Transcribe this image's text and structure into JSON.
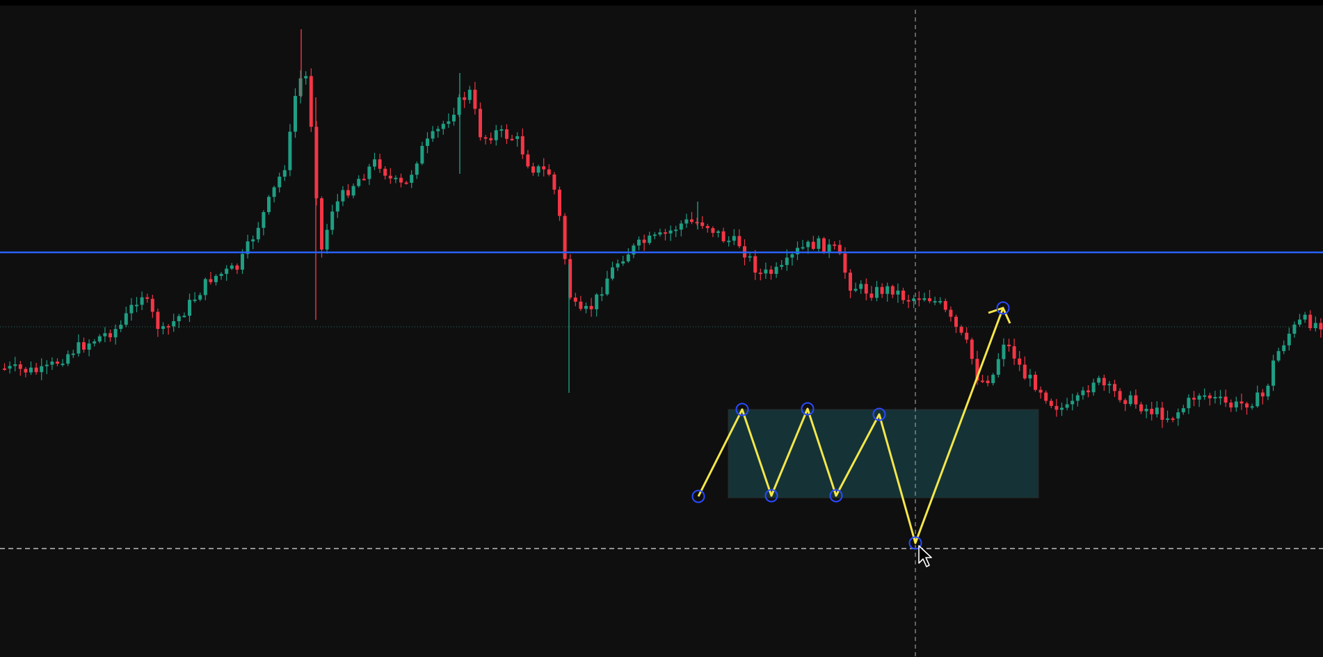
{
  "colors": {
    "background": "#0f0f10",
    "top_bar": "#000000",
    "candle_up": "#1f9e83",
    "candle_down": "#f23645",
    "level_line": "#2962ff",
    "dotted_level": "#1f7a63",
    "crosshair": "#9a9a9a",
    "pattern_line": "#f5e74a",
    "pattern_handle": "#2a4bff",
    "pattern_box_fill": "#163a3e",
    "cursor": "#ffffff"
  },
  "chart": {
    "type": "candlestick",
    "horizontal_level": "blue-support-resistance",
    "crosshair": true,
    "pattern_tool": "xabcd-zigzag-with-range-box",
    "pattern_handles": 8
  },
  "cursor_icon": "arrow-pointer"
}
